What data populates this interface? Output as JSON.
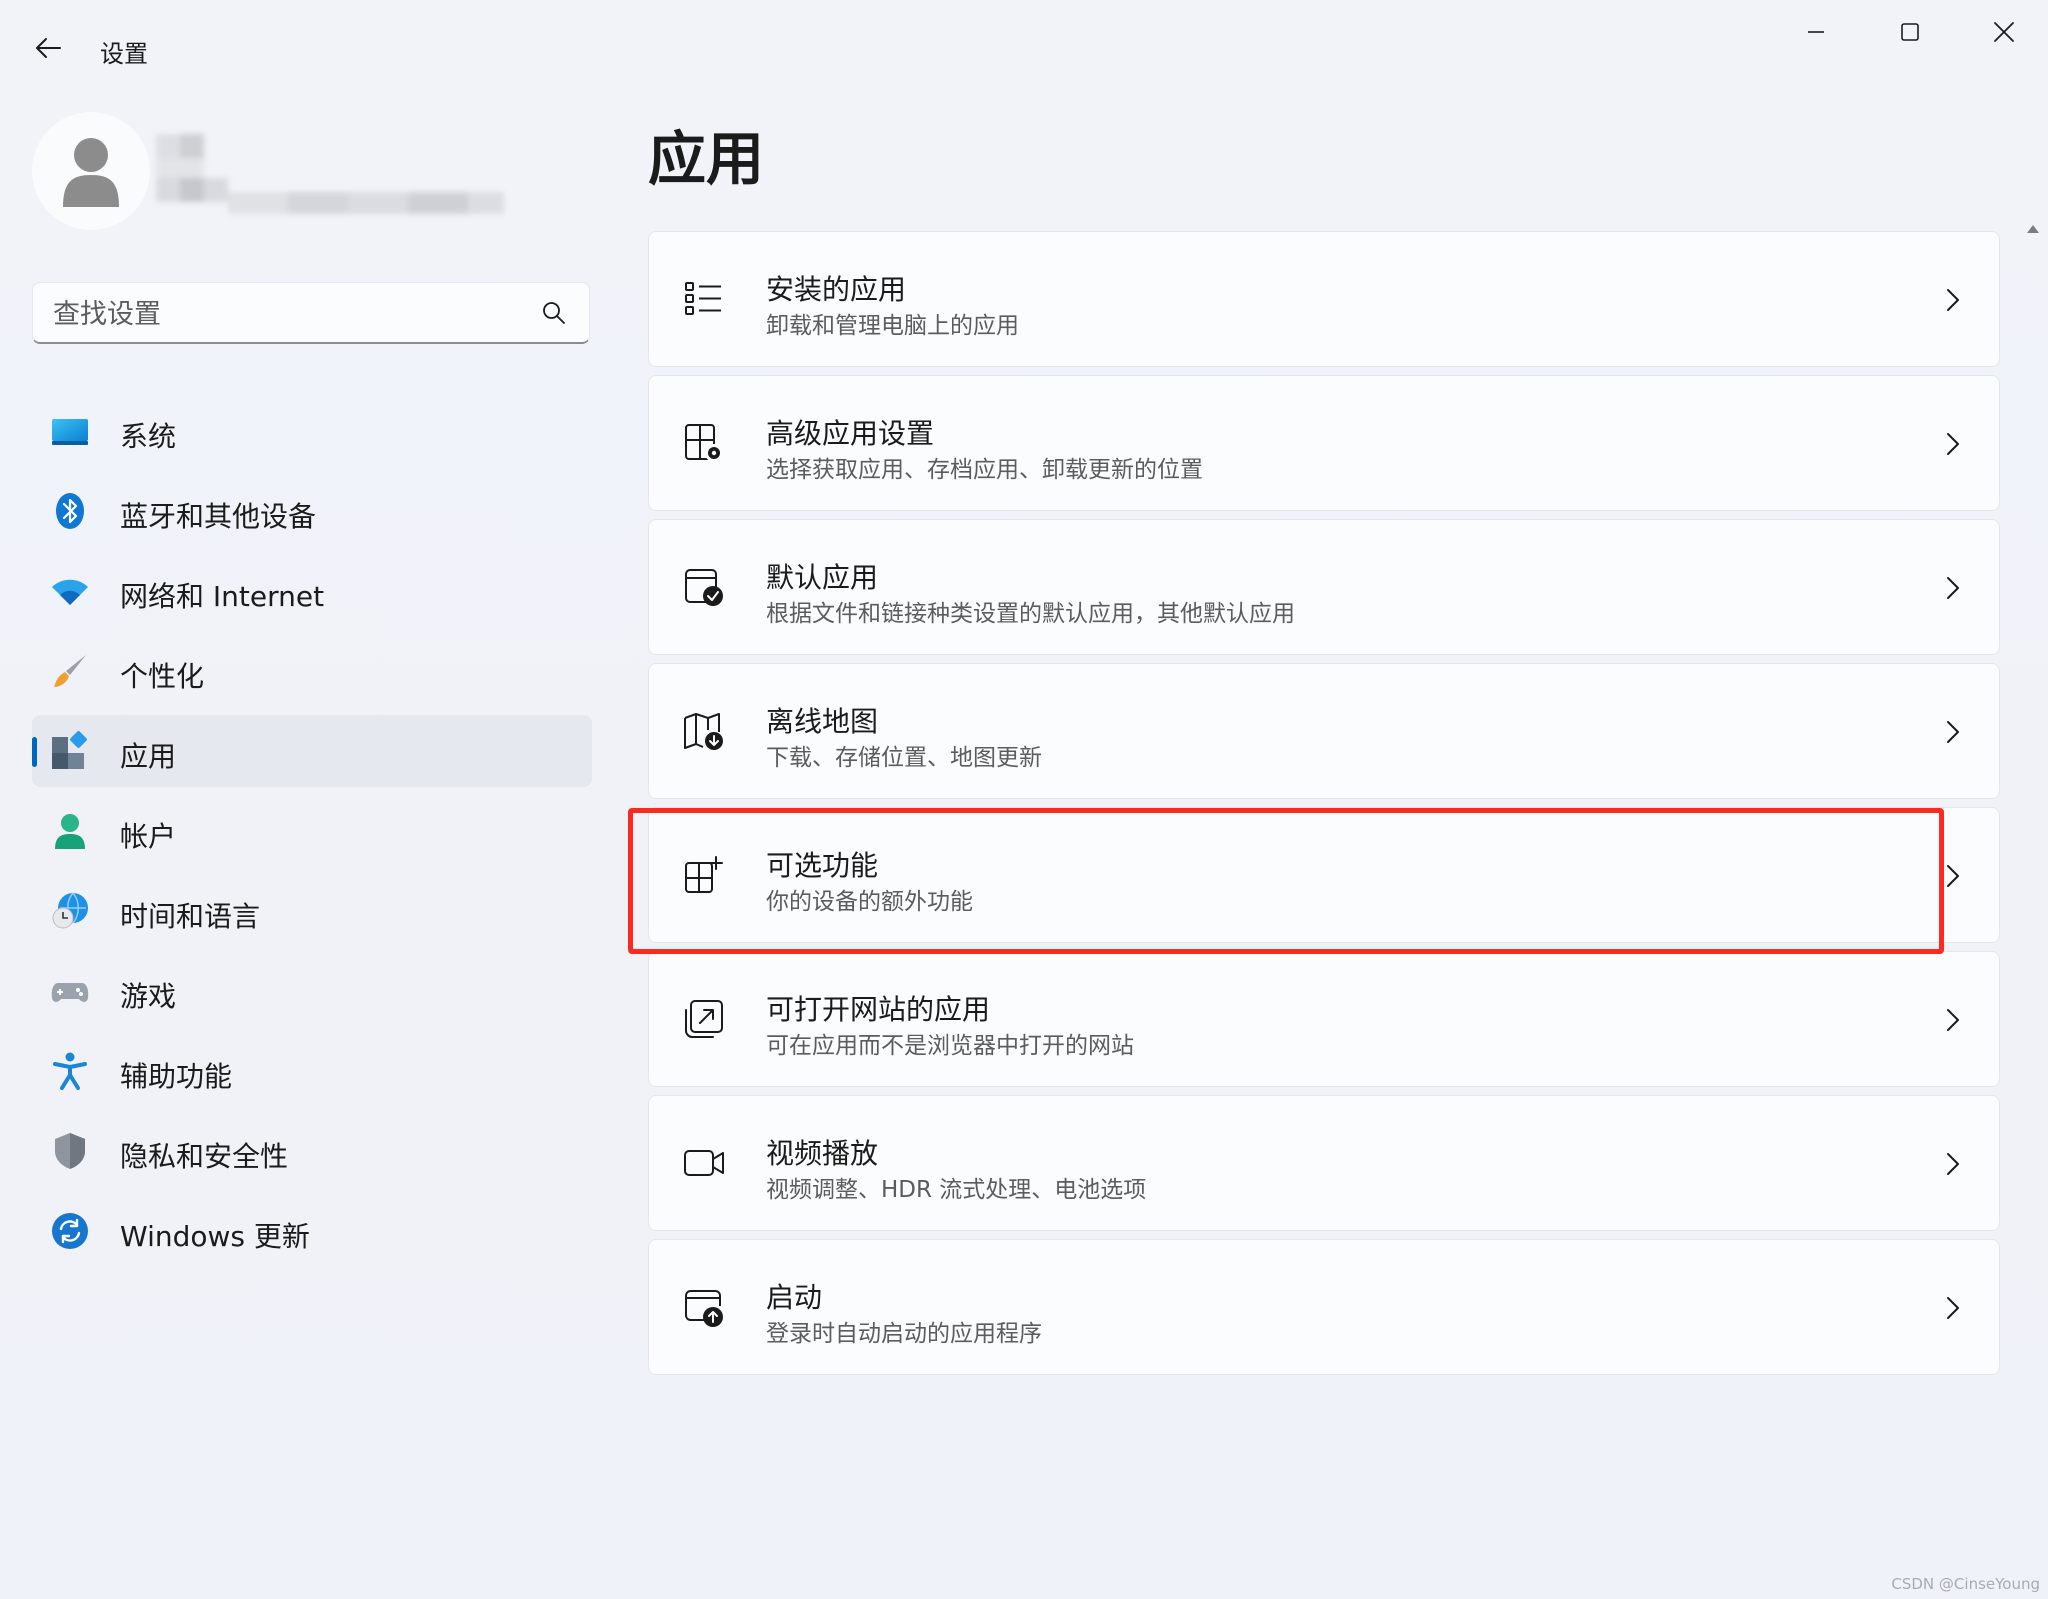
{
  "titlebar": {
    "app_title": "设置"
  },
  "search": {
    "placeholder": "查找设置"
  },
  "sidebar": {
    "items": [
      {
        "label": "系统",
        "icon": "system-monitor-icon"
      },
      {
        "label": "蓝牙和其他设备",
        "icon": "bluetooth-icon"
      },
      {
        "label": "网络和 Internet",
        "icon": "wifi-icon"
      },
      {
        "label": "个性化",
        "icon": "paintbrush-icon"
      },
      {
        "label": "应用",
        "icon": "apps-icon",
        "active": true
      },
      {
        "label": "帐户",
        "icon": "account-icon"
      },
      {
        "label": "时间和语言",
        "icon": "globe-clock-icon"
      },
      {
        "label": "游戏",
        "icon": "gamepad-icon"
      },
      {
        "label": "辅助功能",
        "icon": "accessibility-icon"
      },
      {
        "label": "隐私和安全性",
        "icon": "shield-icon"
      },
      {
        "label": "Windows 更新",
        "icon": "windows-update-icon"
      }
    ]
  },
  "main": {
    "title": "应用",
    "cards": [
      {
        "title": "安装的应用",
        "subtitle": "卸载和管理电脑上的应用",
        "icon": "installed-apps-list-icon"
      },
      {
        "title": "高级应用设置",
        "subtitle": "选择获取应用、存档应用、卸载更新的位置",
        "icon": "advanced-app-settings-icon"
      },
      {
        "title": "默认应用",
        "subtitle": "根据文件和链接种类设置的默认应用，其他默认应用",
        "icon": "default-apps-icon"
      },
      {
        "title": "离线地图",
        "subtitle": "下载、存储位置、地图更新",
        "icon": "offline-map-icon"
      },
      {
        "title": "可选功能",
        "subtitle": "你的设备的额外功能",
        "icon": "optional-features-icon",
        "highlighted": true
      },
      {
        "title": "可打开网站的应用",
        "subtitle": "可在应用而不是浏览器中打开的网站",
        "icon": "apps-for-websites-icon"
      },
      {
        "title": "视频播放",
        "subtitle": "视频调整、HDR 流式处理、电池选项",
        "icon": "video-camera-icon"
      },
      {
        "title": "启动",
        "subtitle": "登录时自动启动的应用程序",
        "icon": "startup-icon"
      }
    ]
  },
  "watermark": "CSDN @CinseYoung",
  "colors": {
    "accent": "#0067c0",
    "highlight_box": "#ff2a1f",
    "window_bg": "#eef1f8",
    "card_bg": "#fbfcfd"
  }
}
